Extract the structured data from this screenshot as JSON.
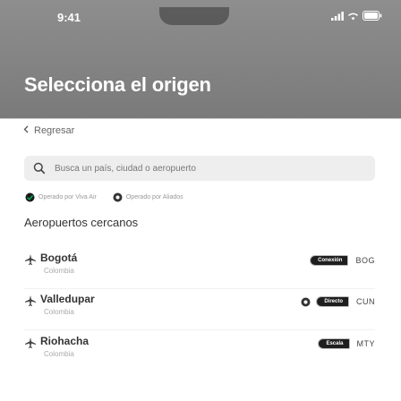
{
  "status_bar": {
    "time": "9:41"
  },
  "header": {
    "title": "Selecciona el origen"
  },
  "nav": {
    "back_label": "Regresar"
  },
  "search": {
    "placeholder": "Busca un país, ciudad o aeropuerto",
    "value": ""
  },
  "legend": {
    "items": [
      {
        "label": "Operado por Viva Air",
        "icon": "viva-air-logo-icon",
        "color": "#00a651"
      },
      {
        "label": "Operado por Aliados",
        "icon": "partner-logo-icon",
        "color": "#333333"
      }
    ]
  },
  "nearby": {
    "section_title": "Aeropuertos cercanos",
    "airports": [
      {
        "city": "Bogotá",
        "country": "Colombia",
        "badge": "Conexión",
        "code": "BOG",
        "operator": "none"
      },
      {
        "city": "Valledupar",
        "country": "Colombia",
        "badge": "Directo",
        "code": "CUN",
        "operator": "partner"
      },
      {
        "city": "Riohacha",
        "country": "Colombia",
        "badge": "Escala",
        "code": "MTY",
        "operator": "none"
      }
    ]
  },
  "colors": {
    "header_bg": "#858585",
    "badge_bg": "#1e1e1e",
    "viva_green": "#00a651"
  }
}
